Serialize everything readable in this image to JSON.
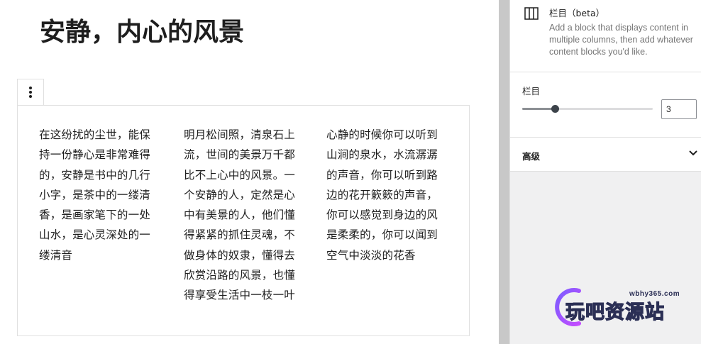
{
  "editor": {
    "title": "安静，内心的风景",
    "columns": [
      {
        "text": "在这纷扰的尘世，能保持一份静心是非常难得的，安静是书中的几行小字，是茶中的一缕清香，是画家笔下的一处山水，是心灵深处的一缕清音"
      },
      {
        "text": "明月松间照，清泉石上流，世间的美景万千都比不上心中的风景。一个安静的人，定然是心中有美景的人，他们懂得紧紧的抓住灵魂，不做身体的奴隶，懂得去欣赏沿路的风景，也懂得享受生活中一枝一叶"
      },
      {
        "text": "心静的时候你可以听到山涧的泉水，水流潺潺的声音，你可以听到路边的花开簌簌的声音，你可以感觉到身边的风是柔柔的，你可以闻到空气中淡淡的花香"
      }
    ],
    "toolbar_icon": "more-vertical-icon"
  },
  "sidebar": {
    "block_card": {
      "icon": "columns-icon",
      "title": "栏目（beta）",
      "description": "Add a block that displays content in multiple columns, then add whatever content blocks you'd like."
    },
    "columns_control": {
      "label": "栏目",
      "value": "3",
      "min": 2,
      "max": 6
    },
    "advanced": {
      "label": "高级",
      "icon": "chevron-down-icon"
    }
  },
  "watermark": {
    "url": "wbhy365.com",
    "text": "玩吧资源站"
  },
  "colors": {
    "border": "#e0e0e0",
    "sidebar_bg": "#f0f0f1",
    "text": "#1e1e1e",
    "muted": "#757575",
    "scrollbar": "#c8c8c8",
    "watermark": "#2b2f55"
  }
}
